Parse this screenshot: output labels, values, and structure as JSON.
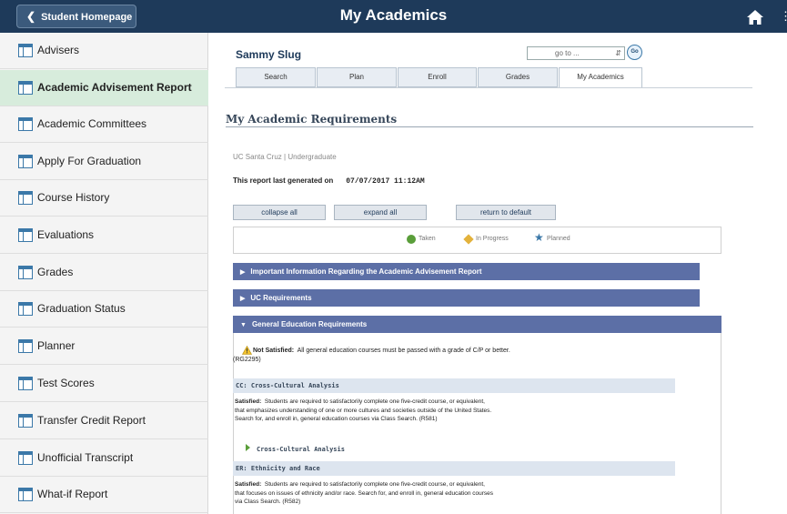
{
  "header": {
    "back_label": "Student Homepage",
    "title": "My Academics"
  },
  "sidebar": {
    "items": [
      {
        "label": "Advisers"
      },
      {
        "label": "Academic Advisement Report",
        "active": true
      },
      {
        "label": "Academic Committees"
      },
      {
        "label": "Apply For Graduation"
      },
      {
        "label": "Course History"
      },
      {
        "label": "Evaluations"
      },
      {
        "label": "Grades"
      },
      {
        "label": "Graduation Status"
      },
      {
        "label": "Planner"
      },
      {
        "label": "Test Scores"
      },
      {
        "label": "Transfer Credit Report"
      },
      {
        "label": "Unofficial Transcript"
      },
      {
        "label": "What-if Report"
      }
    ]
  },
  "student": {
    "name": "Sammy Slug",
    "goto_value": "go to ...",
    "goto_button": "Go"
  },
  "tabs": [
    {
      "label": "Search"
    },
    {
      "label": "Plan"
    },
    {
      "label": "Enroll"
    },
    {
      "label": "Grades"
    },
    {
      "label": "My Academics",
      "active": true
    }
  ],
  "report": {
    "title": "My Academic Requirements",
    "career": "UC Santa Cruz | Undergraduate",
    "generated_label": "This report last generated on",
    "generated_date": "07/07/2017 11:12AM",
    "buttons": {
      "collapse": "collapse all",
      "expand": "expand all",
      "reset": "return to default"
    },
    "legend": {
      "taken": "Taken",
      "in_progress": "In Progress",
      "planned": "Planned"
    },
    "sections": [
      {
        "label": "Important Information Regarding the Academic Advisement Report"
      },
      {
        "label": "UC Requirements"
      },
      {
        "label": "General Education Requirements"
      }
    ],
    "gened": {
      "status": "Not Satisfied:",
      "status_text": "All general education courses must be passed with a grade of C/P or better.",
      "code": "(RG2295)",
      "cc_title": "CC: Cross-Cultural Analysis",
      "cc_status": "Satisfied:",
      "cc_line1": "Students are required to satisfactorily complete one five-credit course, or equivalent,",
      "cc_line2": "that emphasizes understanding of one or more cultures and societies outside of the United States.",
      "cc_line3": "Search for, and enroll in, general education courses via Class Search. (R581)",
      "cc_course": "Cross-Cultural Analysis",
      "er_title": "ER: Ethnicity and Race",
      "er_status": "Satisfied:",
      "er_line1": "Students are required to satisfactorily complete one five-credit course, or equivalent,",
      "er_line2": "that focuses on issues of ethnicity and/or race. Search for, and enroll in, general education courses",
      "er_line3": "via Class Search. (R582)"
    }
  },
  "colors": {
    "header_bg": "#1e3a5a",
    "active_item": "#d7ecdc",
    "section_bar": "#5c6fa6"
  }
}
